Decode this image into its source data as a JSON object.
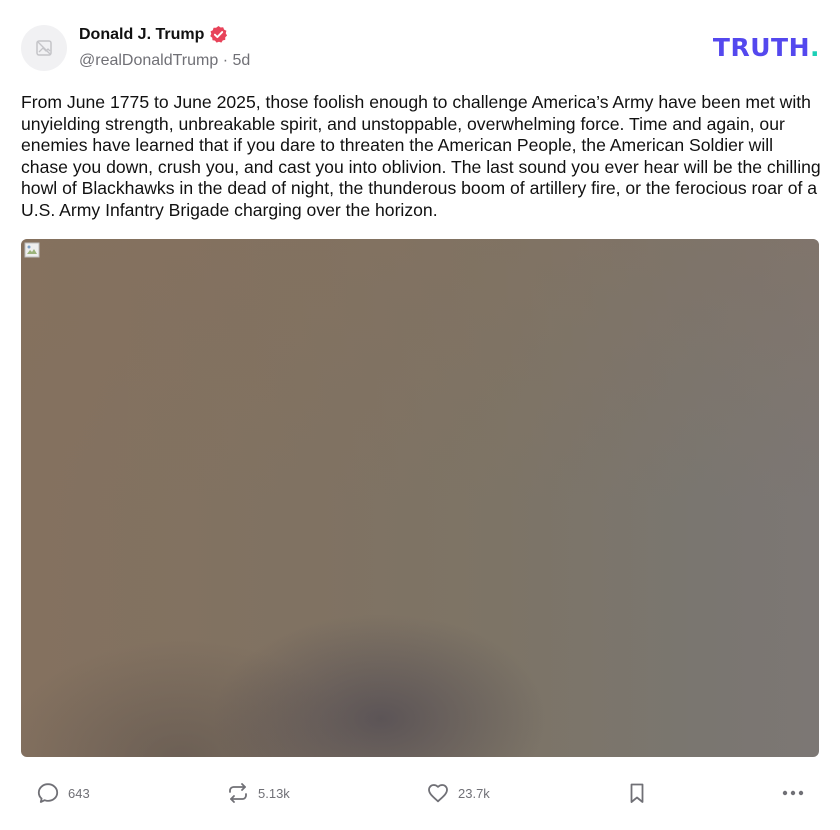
{
  "author": {
    "name": "Donald J. Trump",
    "handle": "@realDonaldTrump",
    "separator": "·",
    "time": "5d",
    "verified_icon": "verified-badge-icon",
    "verified_color": "#e8435a"
  },
  "brand": {
    "logo_text": "TRUTH",
    "logo_dot": ".",
    "logo_color": "#5448ee",
    "dot_color": "#1bd0b6"
  },
  "post": {
    "text": "From June 1775 to June 2025, those foolish enough to challenge America’s Army have been met with unyielding strength, unbreakable spirit, and unstoppable, overwhelming force. Time and again, our enemies have learned that if you dare to threaten the American People, the American Soldier will chase you down, crush you, and cast you into oblivion. The last sound you ever hear will be the chilling howl of Blackhawks in the dead of night, the thunderous boom of artillery fire, or the ferocious roar of a U.S. Army Infantry Brigade charging over the horizon."
  },
  "actions": {
    "replies": "643",
    "retruths": "5.13k",
    "likes": "23.7k"
  }
}
